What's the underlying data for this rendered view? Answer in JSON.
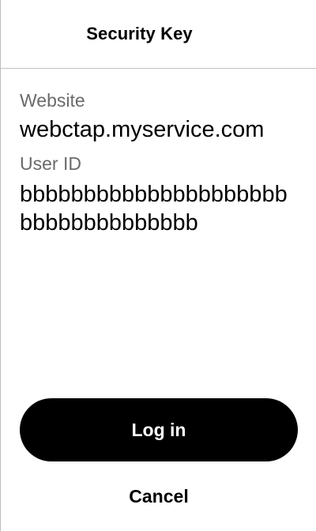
{
  "dialog": {
    "title": "Security Key"
  },
  "fields": {
    "website": {
      "label": "Website",
      "value": "webctap.myservice.com"
    },
    "user_id": {
      "label": "User ID",
      "value": "bbbbbbbbbbbbbbbbbbbbbbbbbbbbbbbbbbb"
    }
  },
  "actions": {
    "login_label": "Log in",
    "cancel_label": "Cancel"
  },
  "colors": {
    "background": "#ffffff",
    "text": "#000000",
    "secondary_text": "#6a6a6a",
    "primary_button": "#000000",
    "primary_button_text": "#ffffff",
    "divider": "#c4c4c4"
  }
}
